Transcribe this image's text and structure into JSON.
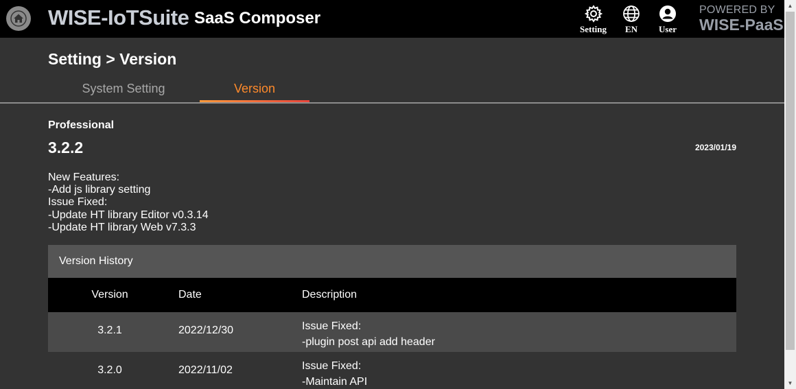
{
  "header": {
    "brand": "WISE-IoTSuite",
    "product": "SaaS Composer",
    "buttons": [
      {
        "label": "Setting",
        "icon": "gear-icon"
      },
      {
        "label": "EN",
        "icon": "globe-icon"
      },
      {
        "label": "User",
        "icon": "user-icon"
      }
    ],
    "powered_by": "POWERED BY",
    "platform": "WISE-PaaS"
  },
  "page": {
    "title": "Setting > Version",
    "tabs": [
      {
        "label": "System Setting",
        "active": false
      },
      {
        "label": "Version",
        "active": true
      }
    ]
  },
  "current": {
    "edition": "Professional",
    "version": "3.2.2",
    "date": "2023/01/19",
    "notes": [
      "New Features:",
      "-Add js library setting",
      "Issue Fixed:",
      "-Update HT library Editor v0.3.14",
      "-Update HT library Web v7.3.3"
    ]
  },
  "history": {
    "title": "Version History",
    "columns": [
      "Version",
      "Date",
      "Description"
    ],
    "rows": [
      {
        "version": "3.2.1",
        "date": "2022/12/30",
        "desc": [
          "Issue Fixed:",
          "-plugin post api add header"
        ]
      },
      {
        "version": "3.2.0",
        "date": "2022/11/02",
        "desc": [
          "Issue Fixed:",
          "-Maintain API"
        ]
      }
    ]
  },
  "colors": {
    "active_tab": "#ff8a2b",
    "header_bg": "#000000",
    "page_bg": "#333333"
  }
}
